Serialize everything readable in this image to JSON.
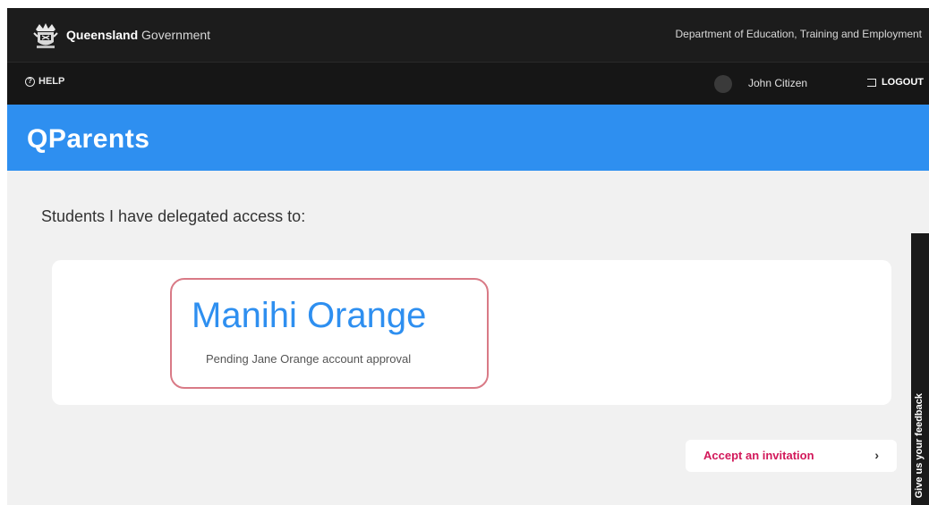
{
  "government": {
    "name_bold": "Queensland",
    "name_light": "Government",
    "department": "Department of Education, Training and Employment"
  },
  "toolbar": {
    "help_label": "HELP",
    "user_name": "John Citizen",
    "logout_label": "LOGOUT"
  },
  "app": {
    "title": "QParents"
  },
  "main": {
    "heading": "Students I have delegated access to:",
    "students": [
      {
        "name": "Manihi Orange",
        "status": "Pending Jane Orange account approval"
      }
    ],
    "invite_label": "Accept an invitation",
    "invite_chevron": "›"
  },
  "feedback": {
    "label": "Give us your feedback"
  },
  "colors": {
    "brand_blue": "#2e8ff0",
    "header_dark": "#1c1c1c",
    "accent_pink": "#d2185a",
    "card_border": "#d97a86"
  }
}
